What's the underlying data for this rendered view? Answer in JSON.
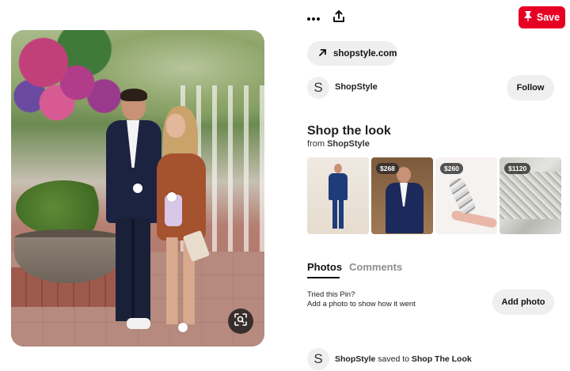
{
  "toolbar": {
    "more_icon": "ellipsis-icon",
    "share_icon": "share-upload-icon",
    "save_label": "Save",
    "save_icon": "pushpin-icon",
    "accent_color": "#e60023"
  },
  "pin": {
    "image_icon": "visual-search-icon",
    "hotspot_count": 4
  },
  "source": {
    "url_label": "shopstyle.com",
    "url_icon": "arrow-up-right-icon",
    "avatar_letter": "S",
    "name": "ShopStyle",
    "follow_label": "Follow"
  },
  "shop": {
    "title": "Shop the look",
    "from_prefix": "from",
    "from_name": "ShopStyle",
    "products": [
      {
        "price": ""
      },
      {
        "price": "$268"
      },
      {
        "price": "$260"
      },
      {
        "price": "$1120"
      }
    ]
  },
  "tabs": {
    "photos": "Photos",
    "comments": "Comments"
  },
  "tried": {
    "line1": "Tried this Pin?",
    "line2": "Add a photo to show how it went",
    "button": "Add photo"
  },
  "saved": {
    "avatar_letter": "S",
    "user": "ShopStyle",
    "middle": "saved to",
    "board": "Shop The Look"
  }
}
